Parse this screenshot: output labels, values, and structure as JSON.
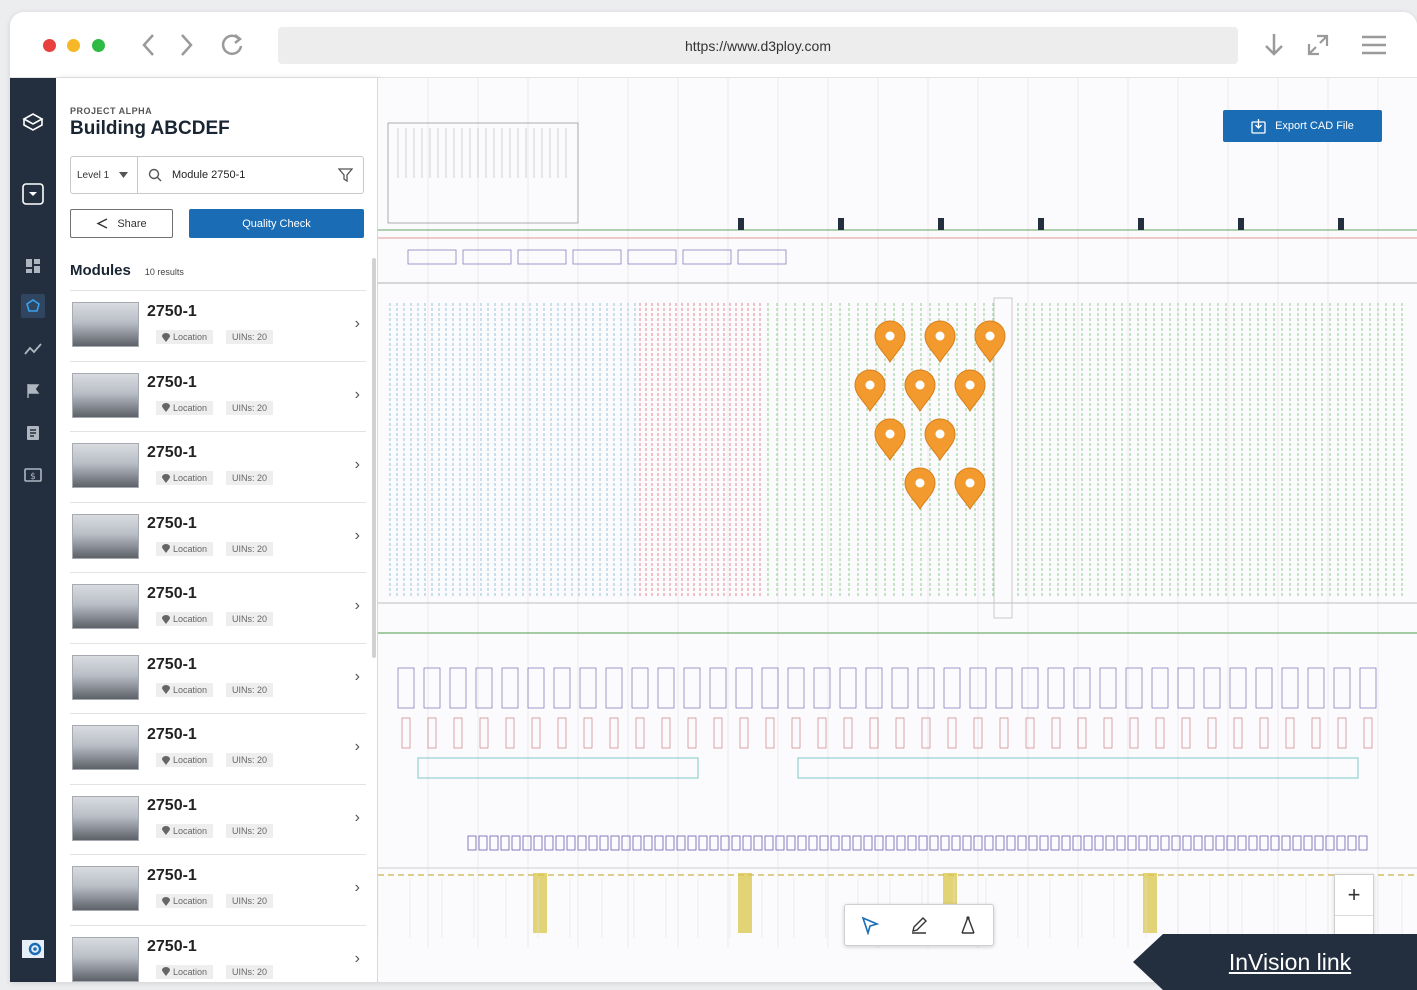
{
  "browser": {
    "url": "https://www.d3ploy.com",
    "traffic_light_colors": [
      "#e8403c",
      "#f6b826",
      "#2dbb45"
    ]
  },
  "project": {
    "label": "PROJECT ALPHA",
    "building": "Building ABCDEF"
  },
  "filters": {
    "level": "Level 1",
    "search_value": "Module 2750-1"
  },
  "actions": {
    "share_label": "Share",
    "quality_check_label": "Quality Check"
  },
  "modules": {
    "title": "Modules",
    "count": "10 results",
    "items": [
      {
        "name": "2750-1",
        "location": "Location",
        "uins": "UINs: 20"
      },
      {
        "name": "2750-1",
        "location": "Location",
        "uins": "UINs: 20"
      },
      {
        "name": "2750-1",
        "location": "Location",
        "uins": "UINs: 20"
      },
      {
        "name": "2750-1",
        "location": "Location",
        "uins": "UINs: 20"
      },
      {
        "name": "2750-1",
        "location": "Location",
        "uins": "UINs: 20"
      },
      {
        "name": "2750-1",
        "location": "Location",
        "uins": "UINs: 20"
      },
      {
        "name": "2750-1",
        "location": "Location",
        "uins": "UINs: 20"
      },
      {
        "name": "2750-1",
        "location": "Location",
        "uins": "UINs: 20"
      },
      {
        "name": "2750-1",
        "location": "Location",
        "uins": "UINs: 20"
      },
      {
        "name": "2750-1",
        "location": "Location",
        "uins": "UINs: 20"
      }
    ]
  },
  "map": {
    "export_label": "Export CAD File",
    "marker_color": "#f39a2e",
    "marker_count": 10
  },
  "overlay": {
    "invision_label": "InVision link"
  },
  "theme": {
    "rail_bg": "#232f3e",
    "primary": "#1a6db5"
  }
}
